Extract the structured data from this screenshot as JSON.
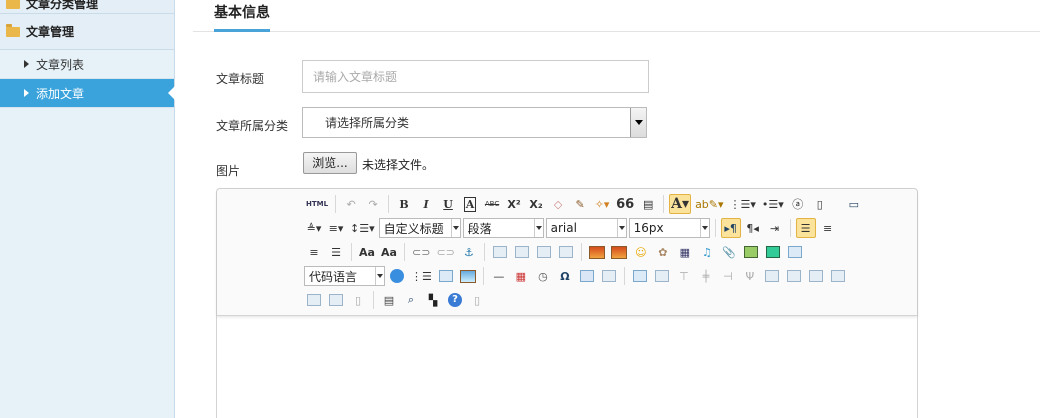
{
  "sidebar": {
    "groups": [
      {
        "label": "文章分类管理"
      },
      {
        "label": "文章管理"
      }
    ],
    "items": [
      {
        "label": "文章列表",
        "active": false
      },
      {
        "label": "添加文章",
        "active": true
      }
    ]
  },
  "tab": {
    "title": "基本信息"
  },
  "form": {
    "title_label": "文章标题",
    "title_placeholder": "请输入文章标题",
    "category_label": "文章所属分类",
    "category_selected": "请选择所属分类",
    "image_label": "图片",
    "browse_label": "浏览...",
    "file_status": "未选择文件。"
  },
  "editor": {
    "html_label": "HTML",
    "custom_title_label": "自定义标题",
    "paragraph_label": "段落",
    "font_family_label": "arial",
    "font_size_label": "16px",
    "code_language_label": "代码语言",
    "bold_label": "B",
    "italic_label": "I",
    "underline_label": "U",
    "font_border_label": "A",
    "strike_label": "ABC",
    "superscript_label": "X²",
    "subscript_label": "X₂",
    "quote_label": "66",
    "forecolor_label": "A",
    "omega_label": "Ω",
    "help_label": "?"
  },
  "colors": {
    "sidebar_bg": "#e6f1f8",
    "active_item": "#3aa3dc",
    "tab_underline": "#4aa3d8",
    "toolbar_active": "#fbe39b"
  }
}
